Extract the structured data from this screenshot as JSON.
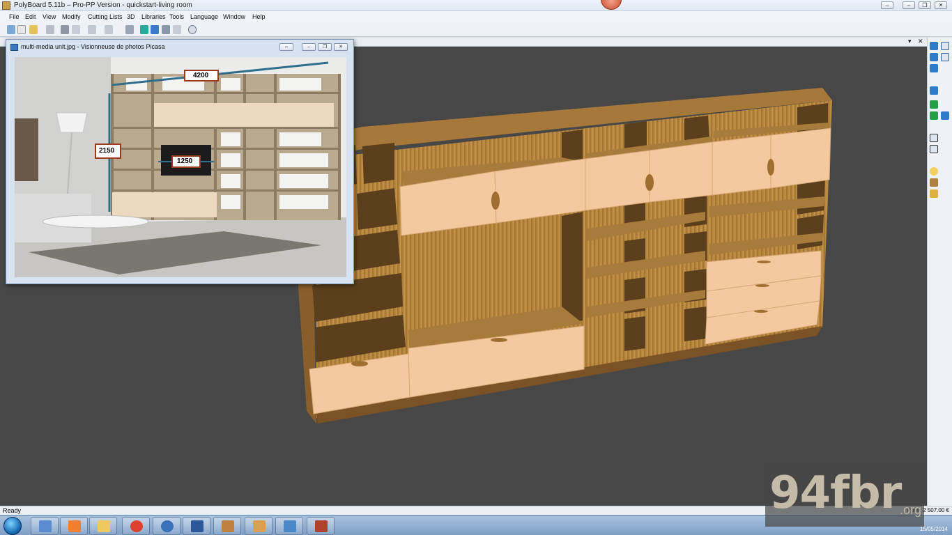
{
  "window": {
    "title": "PolyBoard 5.11b – Pro-PP Version - quickstart-living room",
    "controls": [
      "⇔",
      "–",
      "❐",
      "✕"
    ]
  },
  "menu": {
    "items": [
      "File",
      "Edit",
      "View",
      "Modify",
      "Cutting Lists",
      "3D",
      "Libraries",
      "Tools",
      "Language",
      "Window",
      "Help"
    ]
  },
  "toolbar": {
    "icons": [
      "new-icon",
      "open-icon",
      "folder-icon",
      "save-icon",
      "print-icon",
      "print-preview-icon",
      "undo-icon",
      "redo-icon",
      "properties-icon",
      "cabinet-icon",
      "view-icon",
      "render-icon",
      "refresh-icon",
      "info-icon"
    ]
  },
  "document": {
    "controls": [
      "▾",
      "✕"
    ]
  },
  "picasa": {
    "title": "multi-media unit.jpg - Visionneuse de photos Picasa",
    "controls": [
      "⇔",
      "–",
      "❐",
      "✕"
    ],
    "dimensions": {
      "width": "4200",
      "height": "2150",
      "tv": "1250"
    }
  },
  "palette": {
    "icons": [
      "view-front-icon",
      "view-back-icon",
      "view-left-icon",
      "view-right-icon",
      "view-top-icon",
      "view-iso-icon",
      "material-icon",
      "texture-icon",
      "box-icon",
      "cube-icon",
      "panel-icon",
      "light-icon",
      "door-icon",
      "color-icon"
    ]
  },
  "status": {
    "left": "Ready",
    "right": "Price: 2 507.00 €"
  },
  "taskbar": {
    "apps": [
      "launcher-app",
      "media-player-app",
      "explorer-app",
      "chrome-app",
      "tool-app",
      "word-app",
      "polyboard-app",
      "opti-app",
      "picasa-app",
      "cutting-app"
    ],
    "clock": "15/05/2014"
  },
  "watermark": {
    "text": "94fbr",
    "domain": ".org"
  },
  "colors": {
    "viewport": "#474747",
    "wood": "#a97a3c",
    "door": "#f4c9a0"
  }
}
